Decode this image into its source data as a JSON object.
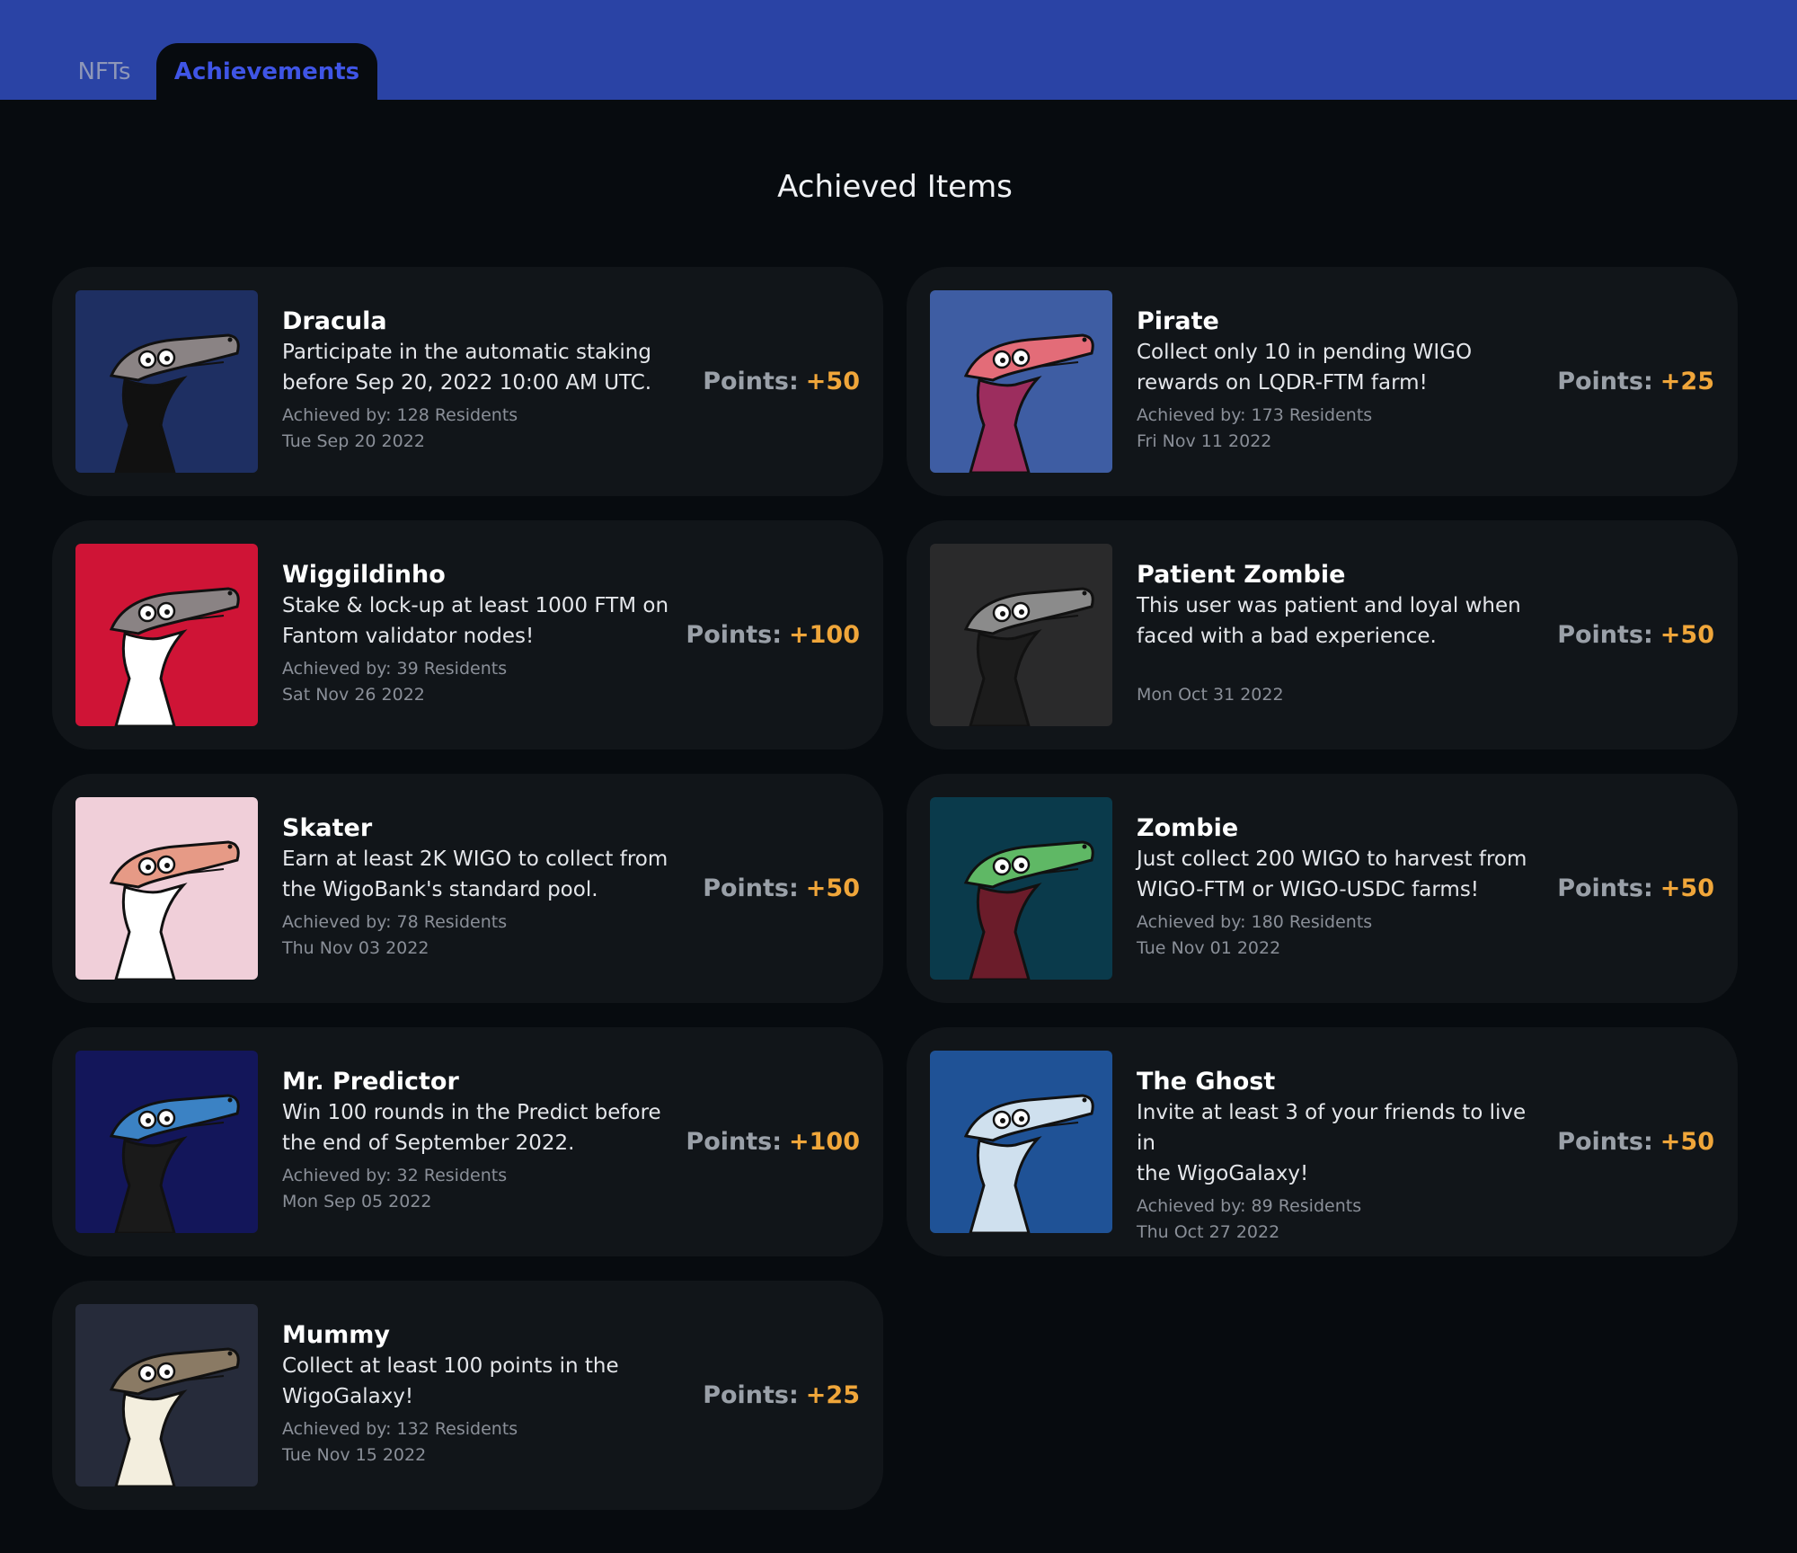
{
  "tabs": [
    {
      "label": "NFTs",
      "active": false
    },
    {
      "label": "Achievements",
      "active": true
    }
  ],
  "section_title": "Achieved Items",
  "points_label": "Points:",
  "colors": {
    "header_bg": "#2a43a5",
    "active_tab_text": "#3f55e6",
    "points_value": "#f0a63a"
  },
  "achievements": [
    {
      "name": "Dracula",
      "desc1": "Participate in the automatic staking",
      "desc2": "before Sep 20, 2022 10:00 AM UTC.",
      "achieved_by": "Achieved by: 128 Residents",
      "date": "Tue Sep 20 2022",
      "points": "+50",
      "icon": "dracula-avatar-icon",
      "thumb_bg": "#1e2f62"
    },
    {
      "name": "Pirate",
      "desc1": "Collect only 10 in pending WIGO",
      "desc2": "rewards on LQDR-FTM farm!",
      "achieved_by": "Achieved by: 173 Residents",
      "date": "Fri Nov 11 2022",
      "points": "+25",
      "icon": "pirate-avatar-icon",
      "thumb_bg": "#3e5da3"
    },
    {
      "name": "Wiggildinho",
      "desc1": "Stake & lock-up at least 1000 FTM on",
      "desc2": "Fantom validator nodes!",
      "achieved_by": "Achieved by: 39 Residents",
      "date": "Sat Nov 26 2022",
      "points": "+100",
      "icon": "footballer-avatar-icon",
      "thumb_bg": "#cf1436"
    },
    {
      "name": "Patient Zombie",
      "desc1": "This user was patient and loyal when",
      "desc2": "faced with a bad experience.",
      "achieved_by": "",
      "date": "Mon Oct 31 2022",
      "points": "+50",
      "icon": "grey-zombie-avatar-icon",
      "thumb_bg": "#2a2a2b"
    },
    {
      "name": "Skater",
      "desc1": "Earn at least 2K WIGO to collect from",
      "desc2": "the WigoBank's standard pool.",
      "achieved_by": "Achieved by: 78 Residents",
      "date": "Thu Nov 03 2022",
      "points": "+50",
      "icon": "skater-avatar-icon",
      "thumb_bg": "#f0cfd9"
    },
    {
      "name": "Zombie",
      "desc1": "Just collect 200 WIGO to harvest from",
      "desc2": "WIGO-FTM or WIGO-USDC farms!",
      "achieved_by": "Achieved by: 180 Residents",
      "date": "Tue Nov 01 2022",
      "points": "+50",
      "icon": "zombie-avatar-icon",
      "thumb_bg": "#0a3a4b"
    },
    {
      "name": "Mr. Predictor",
      "desc1": "Win 100 rounds in the Predict before",
      "desc2": "the end of September 2022.",
      "achieved_by": "Achieved by: 32 Residents",
      "date": "Mon Sep 05 2022",
      "points": "+100",
      "icon": "predictor-avatar-icon",
      "thumb_bg": "#13165a"
    },
    {
      "name": "The Ghost",
      "desc1": "Invite at least 3 of your friends to live in",
      "desc2": "the WigoGalaxy!",
      "achieved_by": "Achieved by: 89 Residents",
      "date": "Thu Oct 27 2022",
      "points": "+50",
      "icon": "ghost-avatar-icon",
      "thumb_bg": "#1f5296"
    },
    {
      "name": "Mummy",
      "desc1": "Collect at least 100 points in the",
      "desc2": "WigoGalaxy!",
      "achieved_by": "Achieved by: 132 Residents",
      "date": "Tue Nov 15 2022",
      "points": "+25",
      "icon": "mummy-avatar-icon",
      "thumb_bg": "#262b3a"
    }
  ]
}
